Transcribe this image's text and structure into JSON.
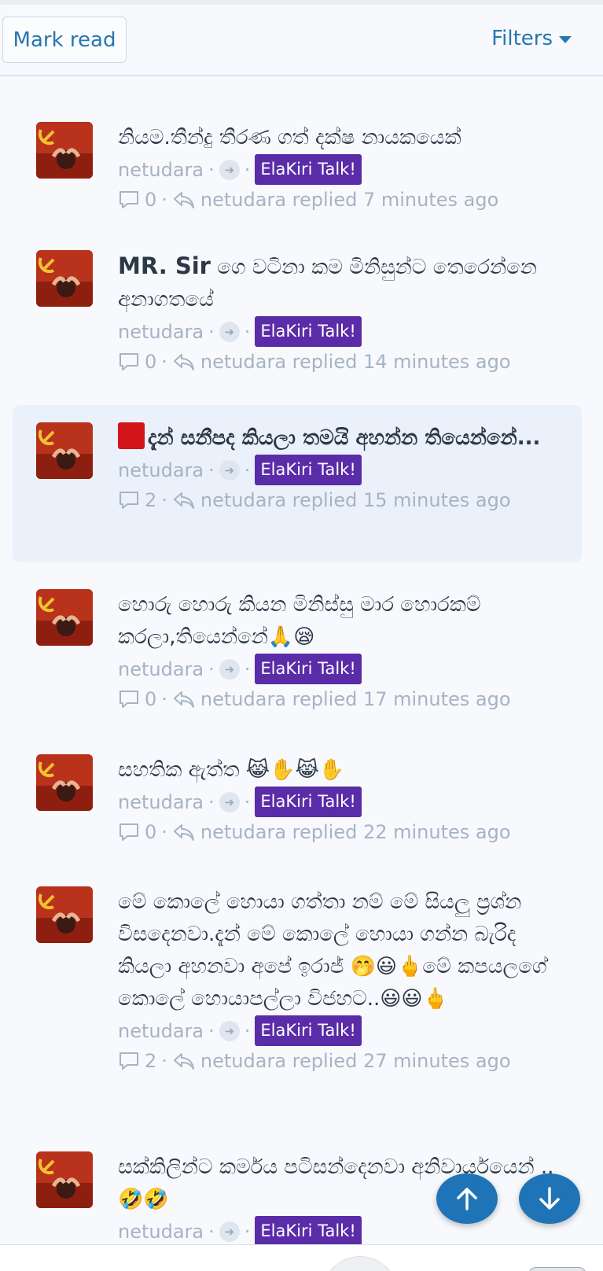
{
  "toolbar": {
    "mark_read_label": "Mark read",
    "filters_label": "Filters"
  },
  "threads": [
    {
      "title_bold": "",
      "title": "නියම.තීන්දු තීරණ ගත් දක්ෂ නායකයෙක්",
      "author": "netudara",
      "forum": "ElaKiri Talk!",
      "replies": "0",
      "last_reply": "netudara replied 7 minutes ago"
    },
    {
      "title_bold": "MR. Sir",
      "title": " ගෙ වටිනා කම මිනිසුන්ට තෙරෙන්නෙ අනාගතයේ",
      "author": "netudara",
      "forum": "ElaKiri Talk!",
      "replies": "0",
      "last_reply": "netudara replied 14 minutes ago"
    },
    {
      "title_bold": "",
      "title": "දැන් සනීපද කියලා තමයි අහන්න තියෙන්නේ...",
      "author": "netudara",
      "forum": "ElaKiri Talk!",
      "replies": "2",
      "last_reply": "netudara replied 15 minutes ago"
    },
    {
      "title_bold": "",
      "title": "හොරු හොරු කියන මිනිස්සු මාර හොරකම් කරලා,තියෙන්නේ🙏😪",
      "author": "netudara",
      "forum": "ElaKiri Talk!",
      "replies": "0",
      "last_reply": "netudara replied 17 minutes ago"
    },
    {
      "title_bold": "",
      "title": "සහතික ඇත්ත 😹✋😹✋",
      "author": "netudara",
      "forum": "ElaKiri Talk!",
      "replies": "0",
      "last_reply": "netudara replied 22 minutes ago"
    },
    {
      "title_bold": "",
      "title": "මේ කොලේ හොයා ගත්තා නම් මේ සියලු ප්‍රශ්න විසදෙනවා.දැන් මේ කොලේ හොයා ගන්න බැරිද කියලා අහනවා අපේ ඉරාජ් 🤭😃🖕මේ කපයලගේ කොලේ හොයාපල්ලා විජහට..😃😃🖕",
      "author": "netudara",
      "forum": "ElaKiri Talk!",
      "replies": "2",
      "last_reply": "netudara replied 27 minutes ago"
    },
    {
      "title_bold": "",
      "title": "සක්කිලින්ට කර්මය පටිසන්දෙනවා අනිවාර්යයෙන් ..🤣🤣",
      "author": "netudara",
      "forum": "ElaKiri Talk!",
      "replies": "",
      "last_reply": ""
    }
  ],
  "colors": {
    "accent": "#2577b1",
    "forum_badge": "#5a2ca8",
    "highlight_row": "#ebf1fb",
    "fab": "#1e74b7"
  },
  "icons": {
    "comment": "comment-icon",
    "reply": "reply-icon",
    "arrow": "arrow-right-circle-icon",
    "scroll_up": "arrow-up-icon",
    "scroll_down": "arrow-down-icon"
  }
}
